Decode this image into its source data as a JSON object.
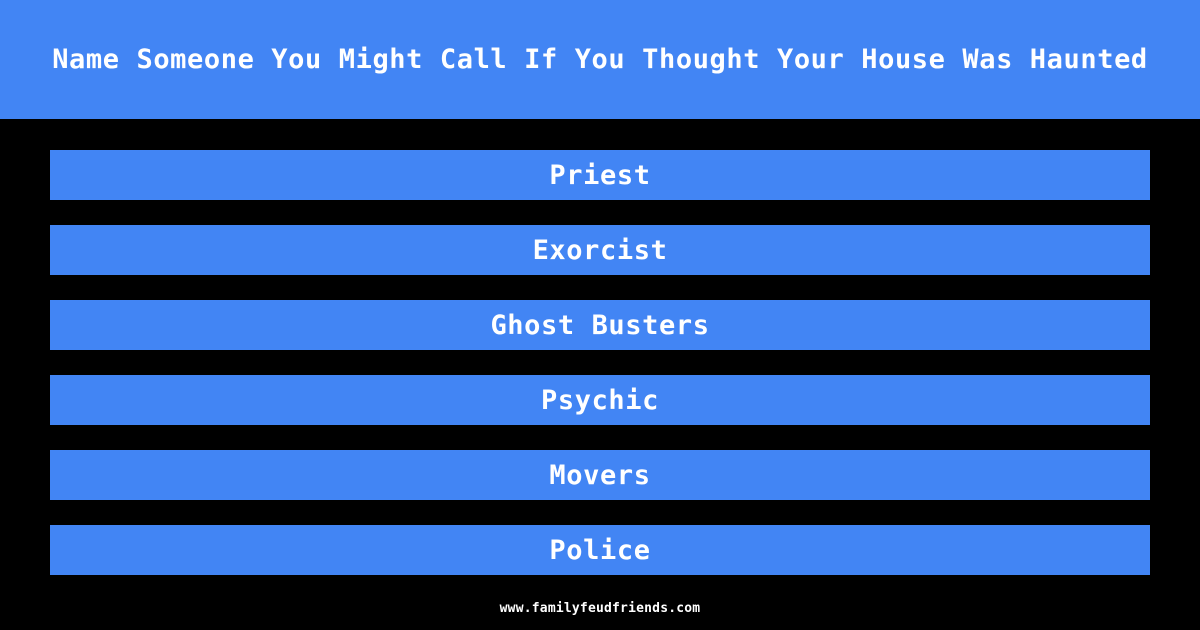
{
  "theme": {
    "background_color": "#000000",
    "accent_color": "#4285f4",
    "text_color": "#ffffff"
  },
  "header": {
    "question": "Name Someone You Might Call If You Thought Your House Was Haunted"
  },
  "answers": [
    {
      "rank": 1,
      "label": "Priest"
    },
    {
      "rank": 2,
      "label": "Exorcist"
    },
    {
      "rank": 3,
      "label": "Ghost Busters"
    },
    {
      "rank": 4,
      "label": "Psychic"
    },
    {
      "rank": 5,
      "label": "Movers"
    },
    {
      "rank": 6,
      "label": "Police"
    }
  ],
  "footer": {
    "url": "www.familyfeudfriends.com"
  }
}
